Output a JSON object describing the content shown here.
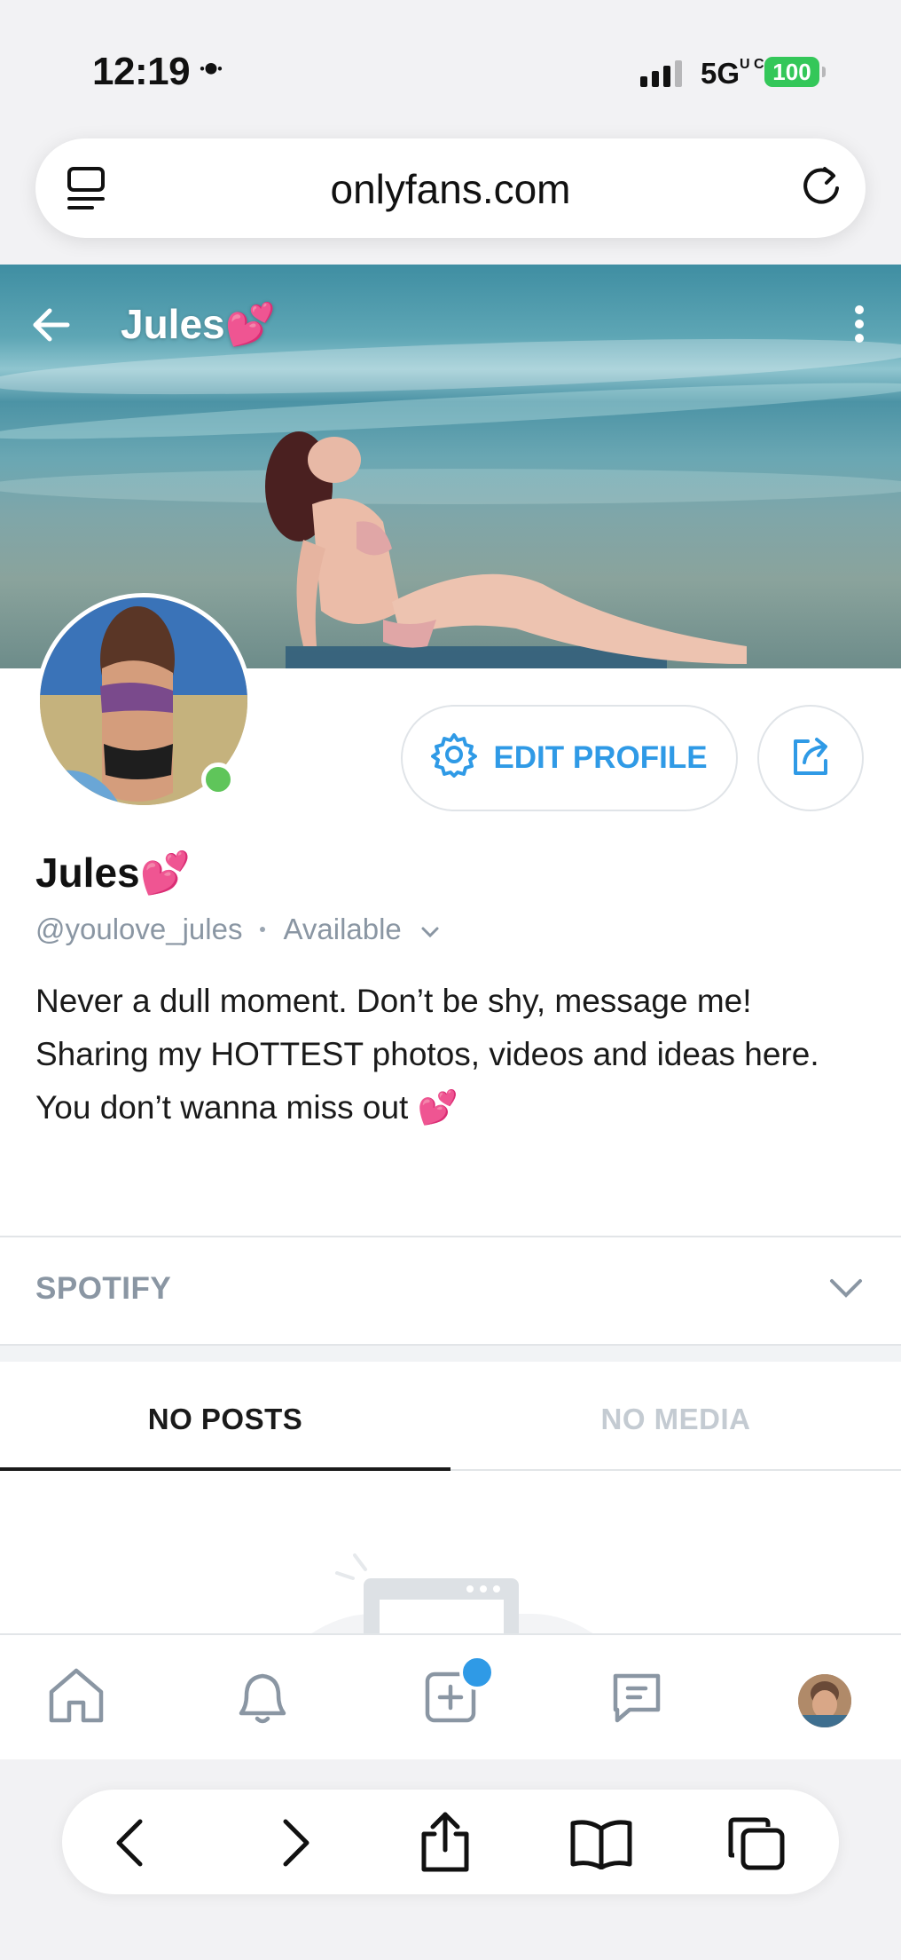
{
  "status_bar": {
    "time": "12:19",
    "extra_glyph": "ꔹ",
    "network": "5G",
    "battery": "100",
    "battery_color": "#34c759"
  },
  "browser": {
    "url": "onlyfans.com"
  },
  "cover": {
    "title": "Jules💕"
  },
  "actions": {
    "edit_profile_label": "EDIT PROFILE"
  },
  "profile": {
    "name": "Jules💕",
    "handle": "@youlove_jules",
    "status": "Available",
    "bio": "Never a dull moment. Don’t be shy, message me! Sharing my HOTTEST photos, videos and ideas here. You don’t wanna miss out 💕"
  },
  "sections": {
    "spotify_label": "SPOTIFY"
  },
  "tabs": [
    {
      "label": "NO POSTS",
      "active": true
    },
    {
      "label": "NO MEDIA",
      "active": false
    }
  ],
  "app_nav": {
    "items": [
      "home-icon",
      "bell-icon",
      "add-post-icon",
      "messages-icon",
      "profile-avatar"
    ]
  },
  "colors": {
    "accent": "#2f9ae6",
    "online": "#5fc55a"
  }
}
